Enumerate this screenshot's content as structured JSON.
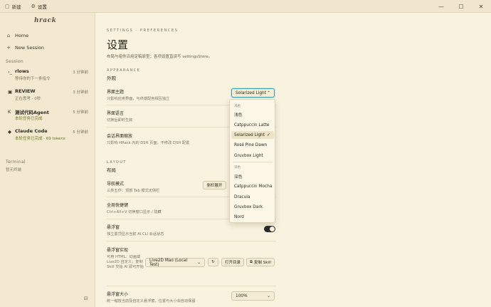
{
  "titlebar": {
    "tabs": [
      {
        "label": "新建",
        "icon": "file-icon"
      },
      {
        "label": "设置",
        "icon": "settings-icon",
        "active": true
      }
    ],
    "controls": {
      "minimize": "—",
      "maximize": "☐",
      "close": "✕"
    }
  },
  "sidebar": {
    "brand": "hrack",
    "nav": [
      {
        "label": "Home",
        "icon": "home-icon"
      },
      {
        "label": "New Session",
        "icon": "plus-icon"
      }
    ],
    "session_label": "Session",
    "sessions": [
      {
        "name": "rlows",
        "time": "3 分钟前",
        "sub": "等待你的下一条指令",
        "icon": "terminal-icon",
        "ok": false
      },
      {
        "name": "REVIEW",
        "time": "3 分钟前",
        "sub": "正在思考 · 0秒",
        "icon": "doc-icon",
        "ok": false
      },
      {
        "name": "测试代码Agent",
        "time": "5 分钟前",
        "sub": "本轮任务已完成",
        "icon": "agent-icon",
        "ok": true
      },
      {
        "name": "Claude Code",
        "time": "5 分钟前",
        "sub": "本轮任务已完成 · 69 tokens",
        "icon": "claude-icon",
        "ok": true
      }
    ],
    "terminal_label": "Terminal",
    "terminal_empty": "暂无终端"
  },
  "main": {
    "crumb": "SETTINGS · PREFERENCES",
    "title": "设置",
    "desc": "布局与组件沿用定稿原型；各项设置直读写 settingsStore。",
    "appearance": {
      "eyebrow": "APPEARANCE",
      "title": "外观",
      "theme_label": "界面主题",
      "theme_hint": "只影响应用界面，与终端配色相互独立",
      "theme_value": "Solarized Light",
      "lang_label": "界面语言",
      "lang_hint": "切换后即时生效",
      "zoom_label": "会话界面缩放",
      "zoom_hint": "只影响 HRack 内的 DSH 页面，不修改 DSH 配置"
    },
    "layout": {
      "eyebrow": "LAYOUT",
      "title": "布局",
      "nav_label": "导航模式",
      "nav_hint": "三类五作：顶部 Tab 模式无侧栏",
      "nav_btn": "侧栏展开",
      "hotkey_label": "全局快捷键",
      "hotkey_hint": "Ctrl+Alt+V 切换窗口显示 / 隐藏",
      "float_label": "悬浮窗",
      "float_hint": "独立置顶显示当前 AI CLI 会话状态",
      "impl_label": "悬浮窗实现",
      "impl_hint": "可用 HTML、动画或 Live2D 自定义；复制 Skill 交给 AI 即可开始",
      "impl_value": "Live2D Mao (Local Test)",
      "open_dir": "打开目录",
      "copy_skill": "复制 Skill",
      "size_label": "悬浮窗大小",
      "size_hint": "统一缩放当前及自定义悬浮窗，位置与大小会自动保留",
      "size_value": "100%"
    }
  },
  "dropdown": {
    "light_group": "浅色",
    "light_items": [
      "浅色",
      "Catppuccin Latte",
      "Solarized Light",
      "Rosé Pine Dawn",
      "Gruvbox Light"
    ],
    "dark_group": "深色",
    "dark_items": [
      "深色",
      "Catppuccin Mocha",
      "Dracula",
      "Gruvbox Dark",
      "Nord"
    ],
    "selected": "Solarized Light"
  },
  "colors": {
    "accent": "#3ea6b3",
    "background": "#f8f2df",
    "sidebar": "#f2e9d0",
    "ok_text": "#6b7a1c"
  }
}
